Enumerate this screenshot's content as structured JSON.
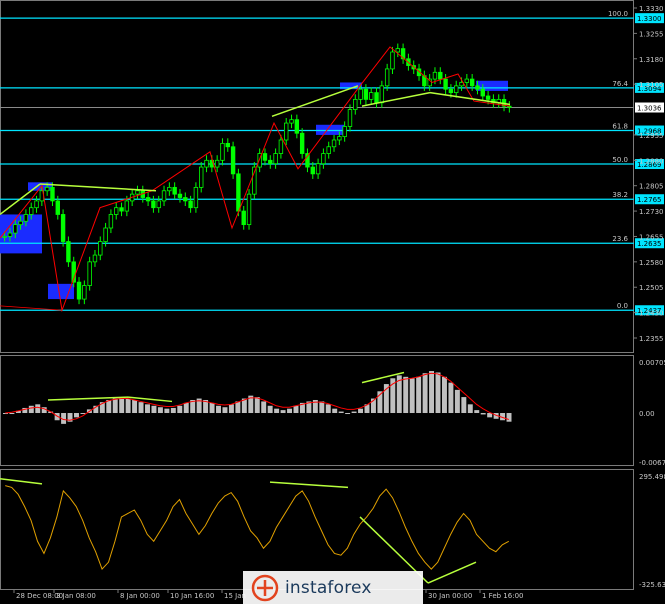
{
  "chart_data": [
    {
      "type": "candlestick",
      "title": "",
      "price_axis": [
        "1.3330",
        "1.3255",
        "1.3180",
        "1.3105",
        "1.3036",
        "1.2955",
        "1.2880",
        "1.2805",
        "1.2730",
        "1.2655",
        "1.2580",
        "1.2505",
        "1.2430",
        "1.2355"
      ],
      "ylim": [
        1.2355,
        1.333
      ],
      "current_price": "1.3036",
      "fibonacci_levels": [
        {
          "level": "100.0",
          "price": "1.3300"
        },
        {
          "level": "76.4",
          "price": "1.3094"
        },
        {
          "level": "61.8",
          "price": "1.2968"
        },
        {
          "level": "50.0",
          "price": "1.2869"
        },
        {
          "level": "38.2",
          "price": "1.2765"
        },
        {
          "level": "23.6",
          "price": "1.2635"
        },
        {
          "level": "0.0",
          "price": "1.2437"
        }
      ],
      "close_series": [
        1.2655,
        1.2665,
        1.269,
        1.27,
        1.272,
        1.274,
        1.276,
        1.279,
        1.28,
        1.276,
        1.272,
        1.264,
        1.258,
        1.252,
        1.247,
        1.251,
        1.258,
        1.26,
        1.264,
        1.268,
        1.272,
        1.274,
        1.273,
        1.276,
        1.278,
        1.279,
        1.277,
        1.276,
        1.274,
        1.276,
        1.279,
        1.28,
        1.278,
        1.277,
        1.276,
        1.274,
        1.28,
        1.286,
        1.288,
        1.286,
        1.288,
        1.293,
        1.292,
        1.284,
        1.273,
        1.269,
        1.278,
        1.286,
        1.29,
        1.288,
        1.287,
        1.29,
        1.294,
        1.299,
        1.3,
        1.296,
        1.29,
        1.286,
        1.284,
        1.287,
        1.29,
        1.292,
        1.294,
        1.295,
        1.298,
        1.303,
        1.306,
        1.309,
        1.306,
        1.308,
        1.305,
        1.31,
        1.315,
        1.32,
        1.321,
        1.318,
        1.316,
        1.315,
        1.313,
        1.31,
        1.312,
        1.314,
        1.312,
        1.309,
        1.308,
        1.31,
        1.311,
        1.312,
        1.31,
        1.309,
        1.307,
        1.306,
        1.305,
        1.306,
        1.304,
        1.3036
      ]
    },
    {
      "type": "bar",
      "title": "",
      "axis": [
        "0.00705",
        "0.00",
        "-0.00677"
      ],
      "ylim": [
        -0.00677,
        0.00705
      ],
      "values": [
        -0.0001,
        0.0,
        0.0003,
        0.0007,
        0.001,
        0.0012,
        0.0008,
        0.0002,
        -0.001,
        -0.0015,
        -0.0012,
        -0.0006,
        0.0,
        0.0005,
        0.001,
        0.0015,
        0.0018,
        0.002,
        0.0022,
        0.002,
        0.0018,
        0.0015,
        0.0012,
        0.001,
        0.0008,
        0.0006,
        0.0007,
        0.001,
        0.0014,
        0.0018,
        0.002,
        0.0018,
        0.0014,
        0.001,
        0.0008,
        0.0012,
        0.0016,
        0.002,
        0.0024,
        0.0022,
        0.0016,
        0.001,
        0.0006,
        0.0004,
        0.0006,
        0.001,
        0.0014,
        0.0016,
        0.0018,
        0.0016,
        0.0012,
        0.0006,
        0.0002,
        0.0,
        0.0002,
        0.0006,
        0.0012,
        0.002,
        0.003,
        0.004,
        0.0048,
        0.0052,
        0.005,
        0.0048,
        0.005,
        0.0055,
        0.0058,
        0.0056,
        0.005,
        0.0042,
        0.0032,
        0.0022,
        0.0012,
        0.0004,
        -0.0002,
        -0.0006,
        -0.0008,
        -0.001,
        -0.0012
      ],
      "signal": [
        0.0,
        0.0001,
        0.0003,
        0.0005,
        0.0007,
        0.0008,
        0.0006,
        0.0002,
        -0.0004,
        -0.0009,
        -0.001,
        -0.0008,
        -0.0004,
        0.0002,
        0.0008,
        0.0013,
        0.0017,
        0.0019,
        0.002,
        0.002,
        0.0018,
        0.0016,
        0.0014,
        0.0012,
        0.001,
        0.0009,
        0.0009,
        0.0011,
        0.0014,
        0.0016,
        0.0017,
        0.0016,
        0.0014,
        0.0012,
        0.0011,
        0.0012,
        0.0015,
        0.0018,
        0.0021,
        0.0021,
        0.0018,
        0.0014,
        0.001,
        0.0008,
        0.0008,
        0.001,
        0.0012,
        0.0014,
        0.0015,
        0.0015,
        0.0013,
        0.001,
        0.0007,
        0.0005,
        0.0005,
        0.0007,
        0.0011,
        0.0017,
        0.0025,
        0.0033,
        0.004,
        0.0045,
        0.0047,
        0.0048,
        0.005,
        0.0053,
        0.0055,
        0.0054,
        0.005,
        0.0044,
        0.0036,
        0.0028,
        0.002,
        0.0012,
        0.0006,
        0.0001,
        -0.0003,
        -0.0006,
        -0.0009
      ]
    },
    {
      "type": "line",
      "title": "",
      "axis": [
        "295.4989",
        "-325.6303"
      ],
      "ylim": [
        -325.6303,
        295.4989
      ],
      "values": [
        240,
        230,
        190,
        120,
        40,
        -80,
        -150,
        -60,
        60,
        210,
        170,
        120,
        40,
        -60,
        -140,
        -240,
        -200,
        -80,
        60,
        80,
        100,
        40,
        -40,
        -80,
        -20,
        40,
        120,
        160,
        80,
        20,
        -40,
        10,
        80,
        140,
        180,
        200,
        150,
        60,
        -20,
        -60,
        -120,
        -80,
        0,
        60,
        120,
        180,
        210,
        150,
        60,
        -20,
        -100,
        -150,
        -160,
        -120,
        -40,
        20,
        60,
        110,
        180,
        220,
        170,
        90,
        0,
        -80,
        -150,
        -200,
        -240,
        -200,
        -120,
        -40,
        30,
        80,
        40,
        -40,
        -80,
        -120,
        -140,
        -100,
        -80
      ]
    }
  ],
  "time_axis": [
    "28 Dec 08:00",
    "3 Jan 08:00",
    "8 Jan 00:00",
    "10 Jan 16:00",
    "15 Jan",
    "30 Jan 00:00",
    "1 Feb 16:00"
  ],
  "brand": {
    "name": "instaforex"
  },
  "colors": {
    "background": "#000000",
    "candles": "#00ff00",
    "fibo": "#00e5ff",
    "zigzag": "#ff0000",
    "divergence": "#b7ff3c",
    "macd_bars": "#c0c0c0",
    "macd_signal": "#ff0000",
    "oscillator": "#e0a000",
    "zones": "#1a2cff"
  }
}
